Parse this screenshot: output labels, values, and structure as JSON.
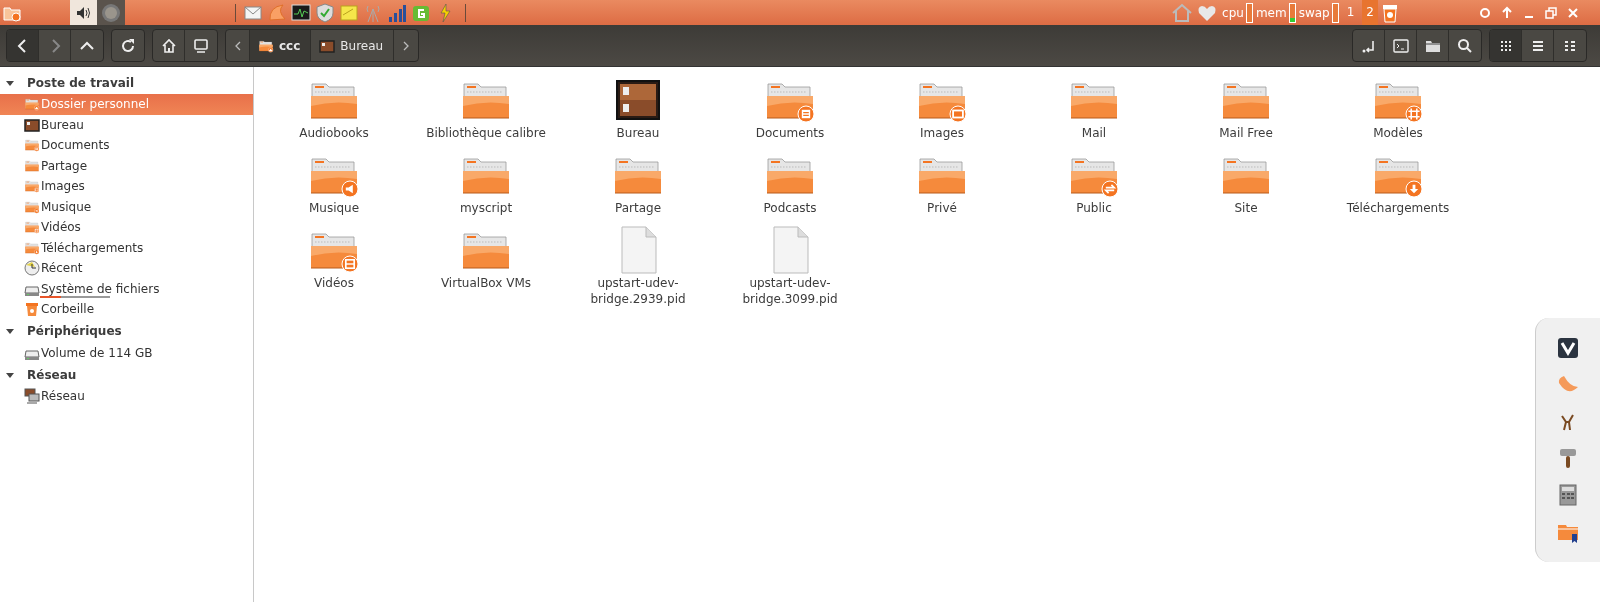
{
  "top_panel": {
    "workspaces": [
      {
        "label": "1",
        "selected": false
      },
      {
        "label": "2",
        "selected": true
      }
    ],
    "meters": [
      {
        "label": "cpu",
        "level": 0
      },
      {
        "label": "mem",
        "level": 0.2
      },
      {
        "label": "swap",
        "level": 0
      }
    ]
  },
  "toolbar": {
    "back": {
      "disabled": false
    },
    "forward": {
      "disabled": true
    },
    "breadcrumbs": [
      {
        "label": "ccc",
        "kind": "home",
        "selected": true
      },
      {
        "label": "Bureau",
        "kind": "desktop",
        "selected": false
      }
    ],
    "views": [
      {
        "kind": "grid",
        "selected": true
      },
      {
        "kind": "list",
        "selected": false
      },
      {
        "kind": "compact",
        "selected": false
      }
    ]
  },
  "sidebar": [
    {
      "title": "Poste de travail",
      "expanded": true,
      "items": [
        {
          "label": "Dossier personnel",
          "kind": "home",
          "selected": true
        },
        {
          "label": "Bureau",
          "kind": "desktop",
          "selected": false
        },
        {
          "label": "Documents",
          "kind": "documents",
          "selected": false
        },
        {
          "label": "Partage",
          "kind": "folder",
          "selected": false
        },
        {
          "label": "Images",
          "kind": "pictures",
          "selected": false
        },
        {
          "label": "Musique",
          "kind": "music",
          "selected": false
        },
        {
          "label": "Vidéos",
          "kind": "videos",
          "selected": false
        },
        {
          "label": "Téléchargements",
          "kind": "downloads",
          "selected": false
        },
        {
          "label": "Récent",
          "kind": "recent",
          "selected": false
        },
        {
          "label": "Système de fichiers",
          "kind": "drive",
          "selected": false,
          "level": 0.3
        },
        {
          "label": "Corbeille",
          "kind": "trash",
          "selected": false
        }
      ]
    },
    {
      "title": "Périphériques",
      "expanded": true,
      "items": [
        {
          "label": "Volume de 114 GB",
          "kind": "drive",
          "selected": false
        }
      ]
    },
    {
      "title": "Réseau",
      "expanded": true,
      "items": [
        {
          "label": "Réseau",
          "kind": "network",
          "selected": false
        }
      ]
    }
  ],
  "files": [
    {
      "name": "Audiobooks",
      "kind": "folder"
    },
    {
      "name": "Bibliothèque calibre",
      "kind": "folder"
    },
    {
      "name": "Bureau",
      "kind": "desktop"
    },
    {
      "name": "Documents",
      "kind": "documents"
    },
    {
      "name": "Images",
      "kind": "pictures"
    },
    {
      "name": "Mail",
      "kind": "folder"
    },
    {
      "name": "Mail Free",
      "kind": "folder"
    },
    {
      "name": "Modèles",
      "kind": "templates"
    },
    {
      "name": "Musique",
      "kind": "music"
    },
    {
      "name": "myscript",
      "kind": "folder"
    },
    {
      "name": "Partage",
      "kind": "folder"
    },
    {
      "name": "Podcasts",
      "kind": "folder"
    },
    {
      "name": "Privé",
      "kind": "folder"
    },
    {
      "name": "Public",
      "kind": "public"
    },
    {
      "name": "Site",
      "kind": "folder"
    },
    {
      "name": "Téléchargements",
      "kind": "downloads"
    },
    {
      "name": "Vidéos",
      "kind": "videos"
    },
    {
      "name": "VirtualBox VMs",
      "kind": "folder"
    },
    {
      "name": "upstart-udev-bridge.2939.pid",
      "kind": "file"
    },
    {
      "name": "upstart-udev-bridge.3099.pid",
      "kind": "file"
    }
  ]
}
